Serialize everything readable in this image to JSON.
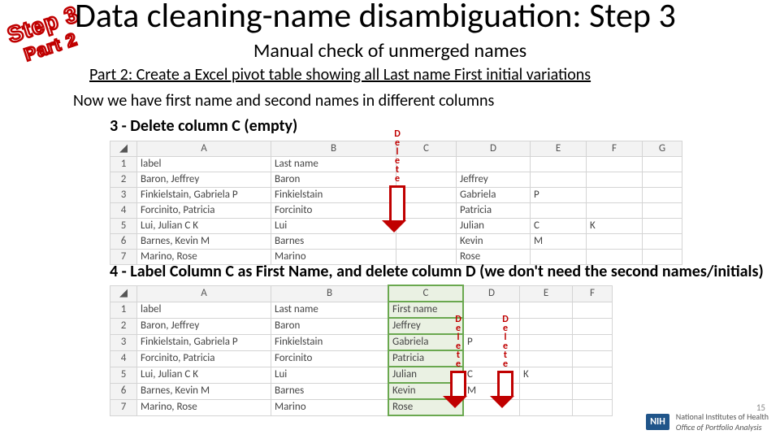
{
  "stamp": {
    "l1": "Step 3",
    "l2": "Part 2"
  },
  "title": "Data cleaning-name disambiguation: Step 3",
  "subtitle": "Manual check of unmerged names",
  "part": "Part 2: Create a Excel pivot table showing all Last name First initial variations",
  "now": "Now we have first name and second names in different columns",
  "step3": "3 - Delete column C (empty)",
  "step4": "4 - Label Column C as First Name, and delete column D (we don't need the second names/initials)",
  "deleteLabel": "D\ne\nl\ne\nt\ne",
  "grid1": {
    "headers": [
      "A",
      "B",
      "C",
      "D",
      "E",
      "F",
      "G"
    ],
    "rows": [
      {
        "n": "1",
        "A": "label",
        "B": "Last name",
        "C": "",
        "D": "",
        "E": "",
        "F": "",
        "G": ""
      },
      {
        "n": "2",
        "A": "Baron, Jeffrey",
        "B": "Baron",
        "C": "",
        "D": "Jeffrey",
        "E": "",
        "F": "",
        "G": ""
      },
      {
        "n": "3",
        "A": "Finkielstain, Gabriela P",
        "B": "Finkielstain",
        "C": "",
        "D": "Gabriela",
        "E": "P",
        "F": "",
        "G": ""
      },
      {
        "n": "4",
        "A": "Forcinito, Patricia",
        "B": "Forcinito",
        "C": "",
        "D": "Patricia",
        "E": "",
        "F": "",
        "G": ""
      },
      {
        "n": "5",
        "A": "Lui, Julian C K",
        "B": "Lui",
        "C": "",
        "D": "Julian",
        "E": "C",
        "F": "K",
        "G": ""
      },
      {
        "n": "6",
        "A": "Barnes, Kevin M",
        "B": "Barnes",
        "C": "",
        "D": "Kevin",
        "E": "M",
        "F": "",
        "G": ""
      },
      {
        "n": "7",
        "A": "Marino, Rose",
        "B": "Marino",
        "C": "",
        "D": "Rose",
        "E": "",
        "F": "",
        "G": ""
      }
    ]
  },
  "grid2": {
    "headers": [
      "A",
      "B",
      "C",
      "D",
      "E",
      "F"
    ],
    "rows": [
      {
        "n": "1",
        "A": "label",
        "B": "Last name",
        "C": "First name",
        "D": "",
        "E": "",
        "F": ""
      },
      {
        "n": "2",
        "A": "Baron, Jeffrey",
        "B": "Baron",
        "C": "Jeffrey",
        "D": "",
        "E": "",
        "F": ""
      },
      {
        "n": "3",
        "A": "Finkielstain, Gabriela P",
        "B": "Finkielstain",
        "C": "Gabriela",
        "D": "P",
        "E": "",
        "F": ""
      },
      {
        "n": "4",
        "A": "Forcinito, Patricia",
        "B": "Forcinito",
        "C": "Patricia",
        "D": "",
        "E": "",
        "F": ""
      },
      {
        "n": "5",
        "A": "Lui, Julian C K",
        "B": "Lui",
        "C": "Julian",
        "D": "C",
        "E": "K",
        "F": ""
      },
      {
        "n": "6",
        "A": "Barnes, Kevin M",
        "B": "Barnes",
        "C": "Kevin",
        "D": "M",
        "E": "",
        "F": ""
      },
      {
        "n": "7",
        "A": "Marino, Rose",
        "B": "Marino",
        "C": "Rose",
        "D": "",
        "E": "",
        "F": ""
      }
    ]
  },
  "footer": {
    "org": "NIH",
    "line1": "National Institutes of Health",
    "line2": "Office of Portfolio Analysis"
  },
  "page": "15"
}
